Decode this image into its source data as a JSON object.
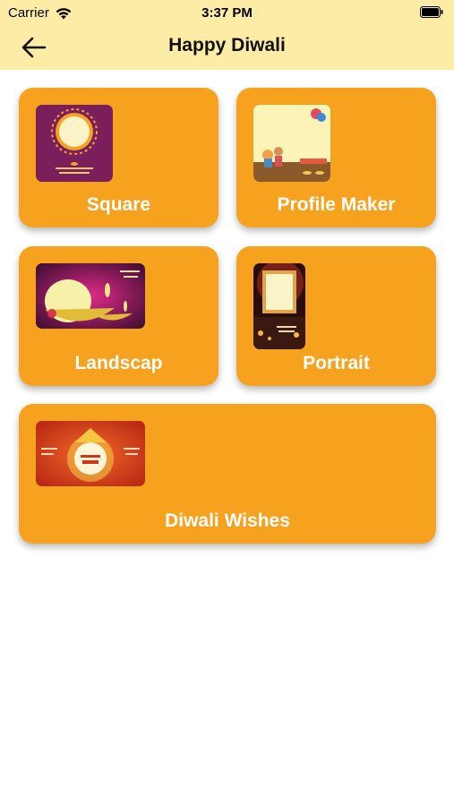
{
  "status_bar": {
    "carrier": "Carrier",
    "time": "3:37 PM"
  },
  "nav": {
    "title": "Happy Diwali",
    "back_icon": "arrow-left-icon"
  },
  "colors": {
    "header_bg": "#fdeca5",
    "card_bg": "#f6a21f",
    "card_text": "#ffffff"
  },
  "cards": [
    {
      "label": "Square"
    },
    {
      "label": "Profile Maker"
    },
    {
      "label": "Landscap"
    },
    {
      "label": "Portrait"
    },
    {
      "label": "Diwali Wishes"
    }
  ]
}
